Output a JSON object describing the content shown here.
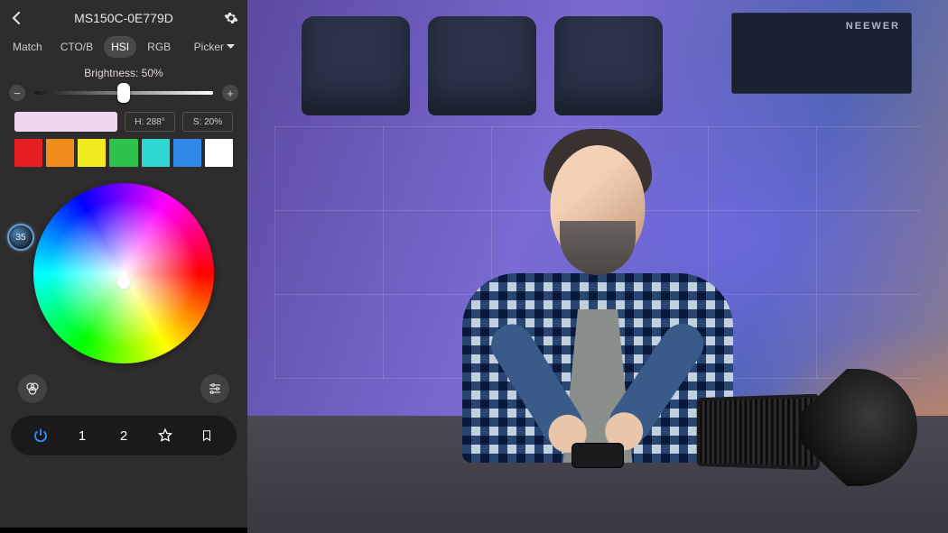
{
  "header": {
    "title": "MS150C-0E779D"
  },
  "tabs": {
    "match": "Match",
    "cto": "CTO/B",
    "hsi": "HSI",
    "rgb": "RGB",
    "picker": "Picker",
    "active": "hsi"
  },
  "brightness": {
    "label": "Brightness: 50%",
    "value": 50
  },
  "hs": {
    "preview_color": "#f0d6ee",
    "hue_label": "H: 288°",
    "sat_label": "S: 20%",
    "hue": 288,
    "sat": 20
  },
  "quick_colors": [
    "#e62020",
    "#f08c1e",
    "#f3ea1f",
    "#2fc24a",
    "#2fd7d2",
    "#2f88e6",
    "#ffffff"
  ],
  "badge": {
    "value": "35"
  },
  "bottom": {
    "preset1": "1",
    "preset2": "2"
  },
  "scene": {
    "brand": "NEEWER"
  }
}
